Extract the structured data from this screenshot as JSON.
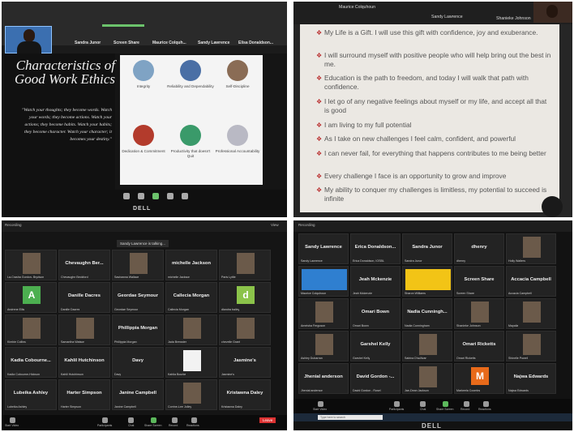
{
  "photo1": {
    "top_strip_names": [
      "Sandra Junor",
      "Screen Share",
      "Maurice Colquh...",
      "Sandy Lawrence",
      "Elisa Donaldson..."
    ],
    "slide_title": "Characteristics of Good Work Ethics",
    "quote": "\"Watch your thoughts; they become words. Watch your words; they become actions. Watch your actions; they become habits. Watch your habits; they become character. Watch your character; it becomes your destiny.\"",
    "cells": [
      {
        "label": "Integrity",
        "color": "#7fa3c4"
      },
      {
        "label": "Reliability and Dependability",
        "color": "#4a6fa5"
      },
      {
        "label": "Self-Discipline",
        "color": "#8a6c55"
      },
      {
        "label": "Dedication & Commitment",
        "color": "#b33b2c"
      },
      {
        "label": "Productivity that doesn't Quit",
        "color": "#3a9a6a"
      },
      {
        "label": "Professional Accountability",
        "color": "#b9b9c4"
      }
    ],
    "brand": "DELL"
  },
  "photo2": {
    "top_names": [
      "Maurice Colquhoun",
      "Sandy Lawrence",
      "Shanieke Johnson"
    ],
    "affirmations": [
      "My Life is a Gift. I will use this gift with confidence, joy and exuberance.",
      "I will surround myself with positive people who will help bring out the best in me.",
      "Education is the path to freedom, and today I will walk that path with confidence.",
      "I let go of any negative feelings about myself or my life, and accept all that is good",
      "I am living to my full potential",
      "As I take on new challenges I feel calm, confident, and powerful",
      "I can never fail, for everything that happens contributes to me being better",
      "Every challenge I face is an opportunity to grow and improve",
      "My ability to conquer my challenges is limitless, my potential to succeed is infinite"
    ]
  },
  "photo3": {
    "header_left": "Recording",
    "header_right": "View",
    "talking": "Sandy Lawrence is talking...",
    "tiles": [
      {
        "name": "",
        "sub": "La-Crasha Gordon- Brydson",
        "kind": "photo"
      },
      {
        "name": "Chevaughn Ber...",
        "sub": "Chevaughn Beckford",
        "kind": "name"
      },
      {
        "name": "",
        "sub": "Sashawna Wallace",
        "kind": "photo"
      },
      {
        "name": "michelle Jackson",
        "sub": "michelle Jackson",
        "kind": "name"
      },
      {
        "name": "",
        "sub": "Paris Lyttle",
        "kind": "photo"
      },
      {
        "name": "",
        "sub": "Andrene Ellis",
        "kind": "avatar",
        "letter": "A",
        "color": "#4caf50"
      },
      {
        "name": "Danille Dacres",
        "sub": "Danille Dacres",
        "kind": "name"
      },
      {
        "name": "Geordae Seymour",
        "sub": "Geordae Seymour",
        "kind": "name"
      },
      {
        "name": "Callecia Morgan",
        "sub": "Callecia Morgan",
        "kind": "name"
      },
      {
        "name": "",
        "sub": "dlandra bailey",
        "kind": "avatar",
        "letter": "d",
        "color": "#8bc34a"
      },
      {
        "name": "",
        "sub": "Kimbie Collins",
        "kind": "photo"
      },
      {
        "name": "",
        "sub": "Samantha Watson",
        "kind": "photo"
      },
      {
        "name": "Phillippia Morgan",
        "sub": "Phillippia Morgan",
        "kind": "name"
      },
      {
        "name": "",
        "sub": "Jada Brewster",
        "kind": "photo"
      },
      {
        "name": "",
        "sub": "chevelle Grant",
        "kind": "photo"
      },
      {
        "name": "Kadia Cobourne...",
        "sub": "Kadia Cobourne-Hickson",
        "kind": "name"
      },
      {
        "name": "Kahlil Hutchinson",
        "sub": "Kahlil Hutchinson",
        "kind": "name"
      },
      {
        "name": "Davy",
        "sub": "Davy",
        "kind": "name"
      },
      {
        "name": "",
        "sub": "Kahlia Bourke",
        "kind": "blank"
      },
      {
        "name": "Jasmine's",
        "sub": "Jasmine's",
        "kind": "name"
      },
      {
        "name": "Lubeika Ashley",
        "sub": "Lubeika Ashley",
        "kind": "name"
      },
      {
        "name": "Harter Simpson",
        "sub": "Harter Simpson",
        "kind": "name"
      },
      {
        "name": "Janine Campbell",
        "sub": "Janine Campbell",
        "kind": "name"
      },
      {
        "name": "",
        "sub": "Corrine-Lee Jolley",
        "kind": "photo"
      },
      {
        "name": "Kristawna Daley",
        "sub": "Kristawna Daley",
        "kind": "name"
      }
    ],
    "toolbar": [
      "Start Video",
      "Participants",
      "Chat",
      "Share Screen",
      "Record",
      "Reactions"
    ],
    "end_label": "Leave"
  },
  "photo4": {
    "header_left": "Recording",
    "tiles": [
      {
        "name": "Sandy Lawrence",
        "sub": "Sandy Lawrence",
        "kind": "name"
      },
      {
        "name": "Erica Donaldson...",
        "sub": "Erica Donaldson, IOSBL",
        "kind": "name"
      },
      {
        "name": "Sandra Junor",
        "sub": "Sandra Junor",
        "kind": "name"
      },
      {
        "name": "dhenry",
        "sub": "dhenry",
        "kind": "name"
      },
      {
        "name": "",
        "sub": "Holly Walters",
        "kind": "photo"
      },
      {
        "name": "",
        "sub": "Maurice Colquhoun",
        "kind": "share"
      },
      {
        "name": "Jeah Mckenzie",
        "sub": "Jeah Mckenzie",
        "kind": "name"
      },
      {
        "name": "",
        "sub": "Sharon Williams",
        "kind": "share2"
      },
      {
        "name": "Screen Share",
        "sub": "Screen Share",
        "kind": "name"
      },
      {
        "name": "Accacia Campbell",
        "sub": "Accacia Campbell",
        "kind": "name"
      },
      {
        "name": "",
        "sub": "Ameisha Ferguson",
        "kind": "photo"
      },
      {
        "name": "Omari Bown",
        "sub": "Omari Bown",
        "kind": "name"
      },
      {
        "name": "Nadia Cunningh...",
        "sub": "Nadia Cunningham",
        "kind": "name"
      },
      {
        "name": "",
        "sub": "Shanieke Johnson",
        "kind": "photo"
      },
      {
        "name": "",
        "sub": "Mayalia",
        "kind": "photo"
      },
      {
        "name": "",
        "sub": "Ashley Dubarran",
        "kind": "photo"
      },
      {
        "name": "Garshel Kelly",
        "sub": "Garshel Kelly",
        "kind": "name"
      },
      {
        "name": "",
        "sub": "Sabina D'sullivan",
        "kind": "photo"
      },
      {
        "name": "Omari Ricketts",
        "sub": "Omari Ricketts",
        "kind": "name"
      },
      {
        "name": "",
        "sub": "Shinelle Powell",
        "kind": "photo"
      },
      {
        "name": "Jhenial anderson",
        "sub": "Jhenial anderson",
        "kind": "name"
      },
      {
        "name": "David Gordon -...",
        "sub": "David Gordon - Rosel",
        "kind": "name"
      },
      {
        "name": "",
        "sub": "Jae-Dean Jackson",
        "kind": "photo"
      },
      {
        "name": "",
        "sub": "Markeela Coombs",
        "kind": "avatar",
        "letter": "M",
        "color": "#e86a1a"
      },
      {
        "name": "Najwa Edwards",
        "sub": "Najwa Edwards",
        "kind": "name"
      }
    ],
    "toolbar": [
      "Start Video",
      "Participants",
      "Chat",
      "Share Screen",
      "Record",
      "Reactions"
    ],
    "search_placeholder": "Type here to search",
    "brand": "DELL"
  }
}
